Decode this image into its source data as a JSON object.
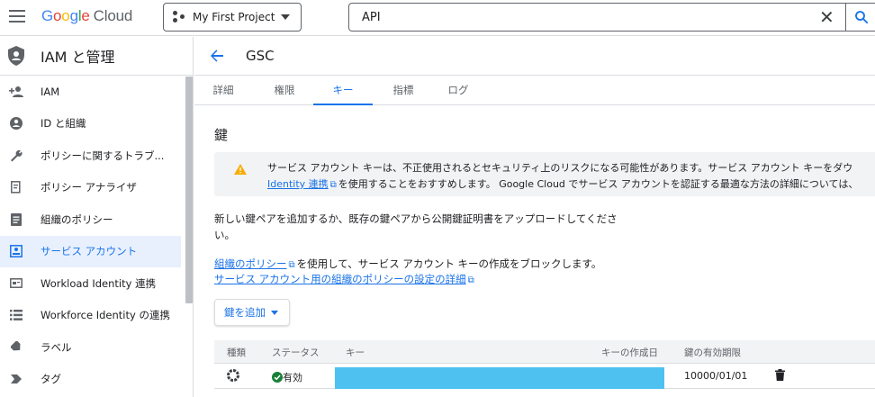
{
  "topbar": {
    "logo_google": [
      "G",
      "o",
      "o",
      "g",
      "l",
      "e"
    ],
    "logo_cloud": "Cloud",
    "project_name": "My First Project",
    "search_value": "API",
    "clear_icon": "close-icon",
    "search_icon": "search-icon"
  },
  "sidebar": {
    "title": "IAM と管理",
    "items": [
      {
        "label": "IAM",
        "icon": "person-add-icon"
      },
      {
        "label": "ID と組織",
        "icon": "account-circle-icon"
      },
      {
        "label": "ポリシーに関するトラブ...",
        "icon": "wrench-icon"
      },
      {
        "label": "ポリシー アナライザ",
        "icon": "document-search-icon"
      },
      {
        "label": "組織のポリシー",
        "icon": "list-document-icon"
      },
      {
        "label": "サービス アカウント",
        "icon": "service-account-icon",
        "active": true
      },
      {
        "label": "Workload Identity 連携",
        "icon": "id-card-icon"
      },
      {
        "label": "Workforce Identity の連携",
        "icon": "list-icon"
      },
      {
        "label": "ラベル",
        "icon": "label-icon"
      },
      {
        "label": "タグ",
        "icon": "tag-icon"
      }
    ]
  },
  "main": {
    "title": "GSC",
    "tabs": [
      {
        "label": "詳細"
      },
      {
        "label": "権限"
      },
      {
        "label": "キー",
        "active": true
      },
      {
        "label": "指標"
      },
      {
        "label": "ログ"
      }
    ],
    "section_title": "鍵",
    "warning": {
      "line1": "サービス アカウント キーは、不正使用されるとセキュリティ上のリスクになる可能性があります。サービス アカウント キーをダウ",
      "line2_link": "Identity 連携",
      "line2_rest": "を使用することをおすすめします。 Google Cloud でサービス アカウントを認証する最適な方法の詳細については、"
    },
    "intro": "新しい鍵ペアを追加するか、既存の鍵ペアから公開鍵証明書をアップロードしてください。",
    "policy_link": "組織のポリシー",
    "policy_text": "を使用して、サービス アカウント キーの作成をブロックします。",
    "policy_detail_link": "サービス アカウント用の組織のポリシーの設定の詳細",
    "add_key_label": "鍵を追加",
    "table": {
      "headers": [
        "種類",
        "ステータス",
        "キー",
        "キーの作成日",
        "鍵の有効期限"
      ],
      "rows": [
        {
          "type_icon": "gear-icon",
          "status": "有効",
          "key": "",
          "created": "",
          "expires": "10000/01/01"
        }
      ]
    }
  }
}
